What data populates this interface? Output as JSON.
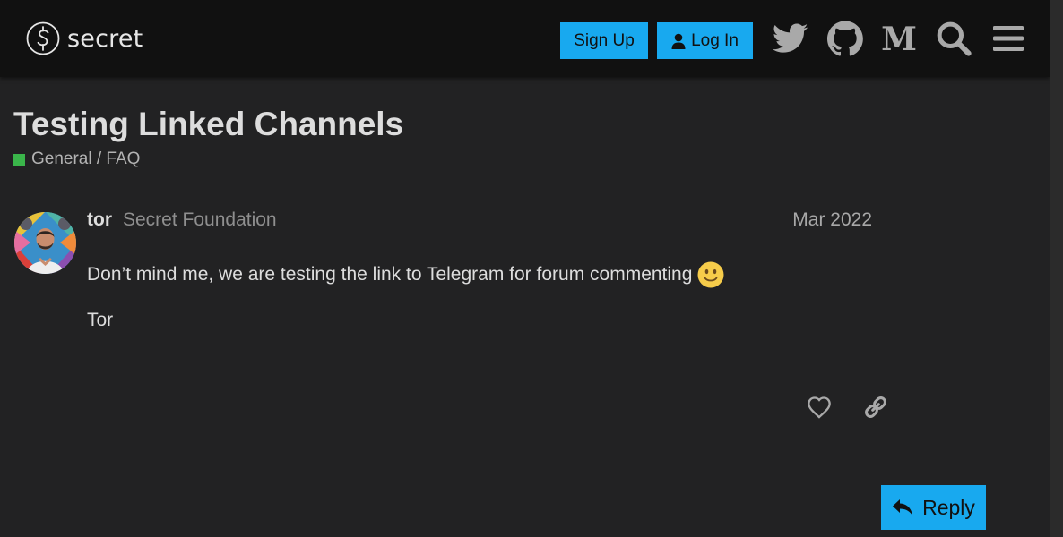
{
  "header": {
    "logo_text": "secret",
    "signup_label": "Sign Up",
    "login_label": "Log In",
    "icons": [
      "twitter-icon",
      "github-icon",
      "medium-icon",
      "search-icon",
      "menu-icon"
    ]
  },
  "topic": {
    "title": "Testing Linked Channels",
    "category": "General / FAQ",
    "category_color": "#3ab54a"
  },
  "post": {
    "username": "tor",
    "full_name": "Secret Foundation",
    "date": "Mar 2022",
    "body": "Don’t mind me, we are testing the link to Telegram for forum commenting",
    "emoji": "slightly-smiling-face",
    "signature": "Tor"
  },
  "actions": {
    "reply_label": "Reply"
  },
  "colors": {
    "accent": "#18a9ef",
    "header_bg": "#111111",
    "page_bg": "#222223"
  }
}
